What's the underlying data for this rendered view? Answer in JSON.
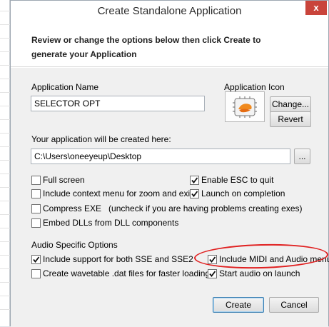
{
  "window": {
    "title": "Create Standalone Application",
    "close_glyph": "x"
  },
  "header": {
    "description": "Review or change the options below then click Create to generate your Application"
  },
  "app_name": {
    "label": "Application Name",
    "value": "SELECTOR OPT"
  },
  "app_icon": {
    "label": "Application Icon",
    "icon": "app-icon-preview",
    "change_label": "Change...",
    "revert_label": "Revert"
  },
  "location": {
    "label": "Your application will be created here:",
    "value": "C:\\Users\\oneeyeup\\Desktop",
    "browse_label": "..."
  },
  "options": {
    "full_screen": {
      "label": "Full screen",
      "checked": false
    },
    "enable_esc": {
      "label": "Enable ESC to quit",
      "checked": true
    },
    "context_menu": {
      "label": "Include context menu for zoom and exit",
      "checked": false
    },
    "launch_on_completion": {
      "label": "Launch on completion",
      "checked": true
    },
    "compress_exe": {
      "label": "Compress EXE   (uncheck if you are having problems creating exes)",
      "checked": false
    },
    "embed_dlls": {
      "label": "Embed DLLs from DLL components",
      "checked": false
    }
  },
  "audio": {
    "section_label": "Audio Specific Options",
    "sse": {
      "label": "Include support for both SSE and SSE2",
      "checked": true
    },
    "midi_audio_menu": {
      "label": "Include MIDI and Audio menu",
      "checked": true
    },
    "wavetable": {
      "label": "Create wavetable .dat files for faster loading",
      "checked": false
    },
    "start_audio": {
      "label": "Start audio on launch",
      "checked": true
    }
  },
  "footer": {
    "create_label": "Create",
    "cancel_label": "Cancel"
  },
  "colors": {
    "annotation": "#e02020",
    "close_button": "#c9443b",
    "default_button_border": "#3c7fb1"
  }
}
